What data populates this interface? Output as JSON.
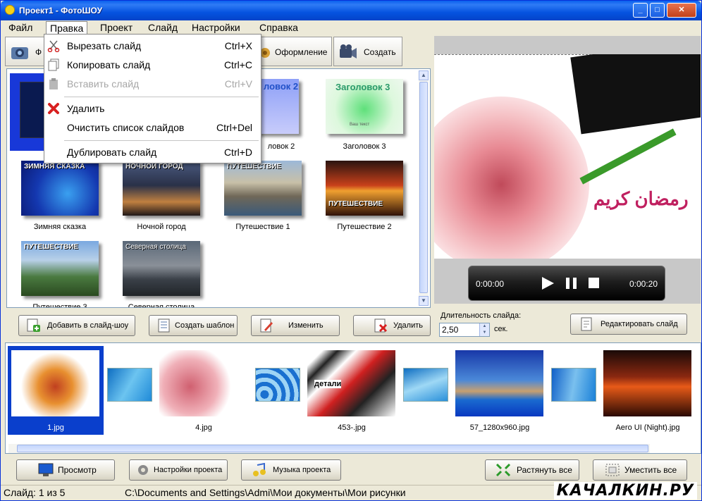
{
  "window": {
    "title": "Проект1 - ФотоШОУ"
  },
  "menubar": {
    "items": [
      "Файл",
      "Правка",
      "Проект",
      "Слайд",
      "Настройки",
      "Справка"
    ]
  },
  "edit_menu": {
    "items": [
      {
        "label": "Вырезать слайд",
        "shortcut": "Ctrl+X",
        "icon": "scissors-icon",
        "enabled": true
      },
      {
        "label": "Копировать слайд",
        "shortcut": "Ctrl+C",
        "icon": "copy-icon",
        "enabled": true
      },
      {
        "label": "Вставить слайд",
        "shortcut": "Ctrl+V",
        "icon": "paste-icon",
        "enabled": false
      },
      {
        "label": "Удалить",
        "shortcut": "",
        "icon": "delete-x-icon",
        "enabled": true
      },
      {
        "label": "Очистить список слайдов",
        "shortcut": "Ctrl+Del",
        "icon": "",
        "enabled": true
      },
      {
        "label": "Дублировать слайд",
        "shortcut": "Ctrl+D",
        "icon": "",
        "enabled": true
      }
    ]
  },
  "tabs": {
    "first_partial": "Ф",
    "design": "Оформление",
    "create": "Создать"
  },
  "templates": [
    {
      "caption": "",
      "title": ""
    },
    {
      "caption": "ловок 2",
      "title": "ловок 2"
    },
    {
      "caption": "Заголовок 3",
      "title": "Заголовок 3",
      "sub": "Ваш текст"
    },
    {
      "caption": "Зимняя сказка",
      "title": "ЗИМНЯЯ СКАЗКА"
    },
    {
      "caption": "Ночной город",
      "title": "НОЧНОЙ ГОРОД"
    },
    {
      "caption": "Путешествие 1",
      "title": "ПУТЕШЕСТВИЕ"
    },
    {
      "caption": "Путешествие 2",
      "title": "ПУТЕШЕСТВИЕ"
    },
    {
      "caption": "Путешествие 3",
      "title": "ПУТЕШЕСТВИЕ"
    },
    {
      "caption": "Северная столица",
      "title": "Северная столица"
    }
  ],
  "gallery_buttons": {
    "add": "Добавить в слайд-шоу",
    "template": "Создать шаблон",
    "edit": "Изменить",
    "delete": "Удалить"
  },
  "player": {
    "time_start": "0:00:00",
    "time_end": "0:00:20"
  },
  "preview": {
    "arabic": "رمضان كريم"
  },
  "duration": {
    "label": "Длительность слайда:",
    "value": "2,50",
    "unit": "сек.",
    "edit_button": "Редактировать слайд"
  },
  "slides": [
    {
      "caption": "1.jpg"
    },
    {
      "caption": "4.jpg"
    },
    {
      "caption": "453-.jpg",
      "overlay": "детали"
    },
    {
      "caption": "57_1280x960.jpg"
    },
    {
      "caption": "Aero UI (Night).jpg"
    }
  ],
  "bottom_buttons": {
    "preview": "Просмотр",
    "settings": "Настройки проекта",
    "music": "Музыка проекта",
    "stretch": "Растянуть все",
    "fit": "Уместить все"
  },
  "status": {
    "slide": "Слайд: 1 из 5",
    "path": "C:\\Documents and Settings\\Admi\\Мои документы\\Мои рисунки"
  },
  "watermark": "КАЧАЛКИН.РУ"
}
